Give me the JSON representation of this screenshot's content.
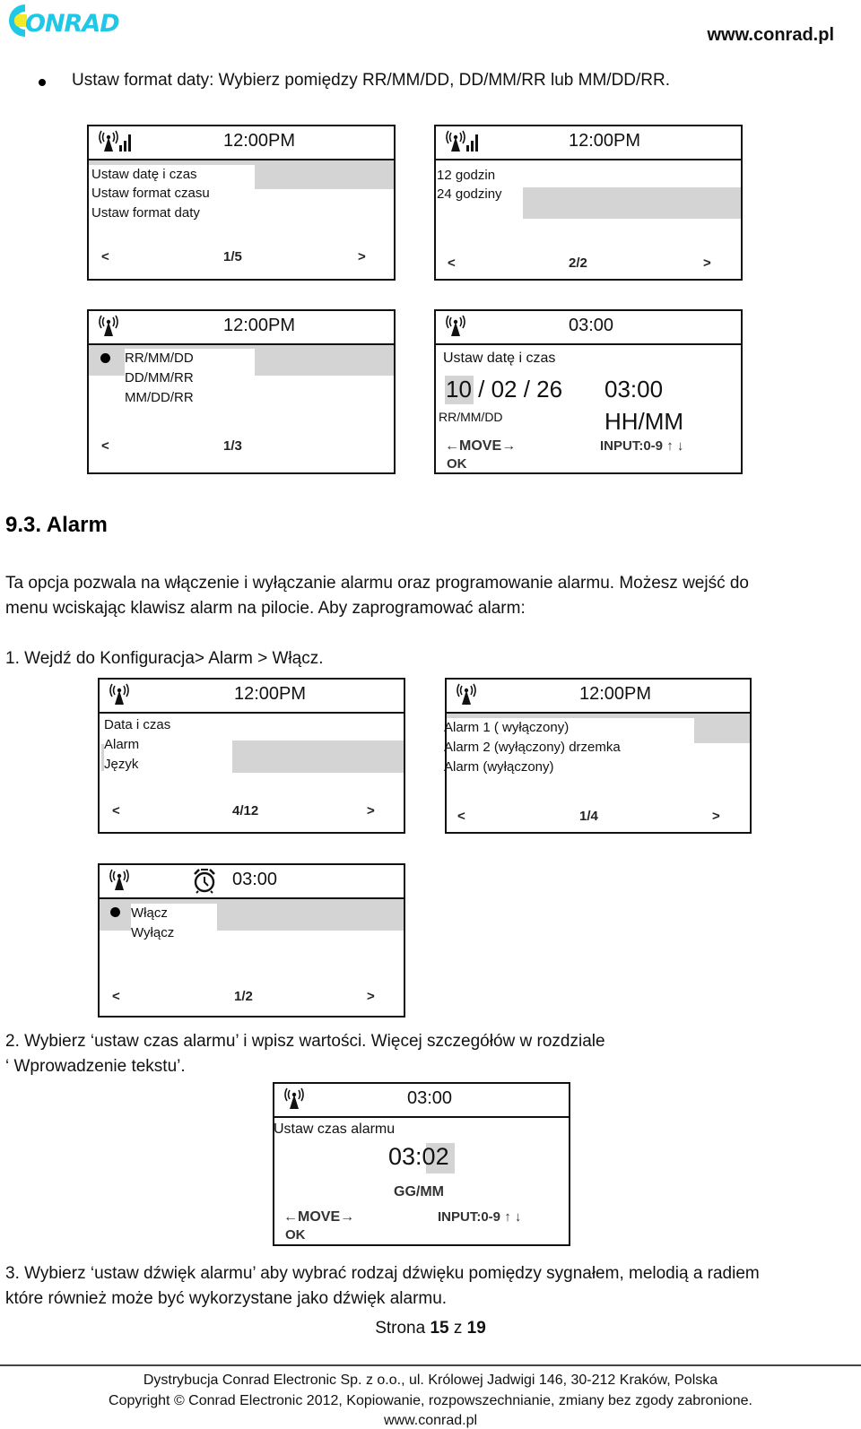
{
  "header": {
    "logo_text": "CONRAD",
    "website": "www.conrad.pl"
  },
  "bullet": "Ustaw format daty: Wybierz pomiędzy RR/MM/DD, DD/MM/RR lub MM/DD/RR.",
  "screens": {
    "s1": {
      "time": "12:00PM",
      "items": [
        "Ustaw datę i czas",
        "Ustaw format czasu",
        "Ustaw format daty"
      ],
      "prev": "<",
      "page": "1/5",
      "next": ">"
    },
    "s2": {
      "time": "12:00PM",
      "items": [
        "12 godzin",
        "24 godziny"
      ],
      "prev": "<",
      "page": "2/2",
      "next": ">"
    },
    "s3": {
      "time": "12:00PM",
      "items": [
        "RR/MM/DD",
        "DD/MM/RR",
        "MM/DD/RR"
      ],
      "prev": "<",
      "page": "1/3"
    },
    "s4": {
      "time": "03:00",
      "title": "Ustaw datę i czas",
      "date_year": "10",
      "date_rest": " / 02 / 26",
      "clock": "03:00",
      "date_format": "RR/MM/DD",
      "time_format": "HH/MM",
      "move": "←MOVE→",
      "input": "INPUT:0-9",
      "arrows": "↑ ↓",
      "ok": "OK"
    },
    "s5": {
      "time": "12:00PM",
      "items": [
        "Data i czas",
        "Alarm",
        "Język"
      ],
      "prev": "<",
      "page": "4/12",
      "next": ">"
    },
    "s6": {
      "time": "12:00PM",
      "items": [
        "Alarm 1 ( wyłączony)",
        "Alarm 2 (wyłączony) drzemka",
        "Alarm (wyłączony)"
      ],
      "prev": "<",
      "page": "1/4",
      "next": ">"
    },
    "s7": {
      "time": "03:00",
      "items": [
        "Włącz",
        "Wyłącz"
      ],
      "prev": "<",
      "page": "1/2",
      "next": ">"
    },
    "s8": {
      "time": "03:00",
      "title": "Ustaw czas alarmu",
      "clock_h": "03:",
      "clock_m": "02",
      "format": "GG/MM",
      "move": "←MOVE→",
      "input": "INPUT:0-9",
      "arrows": "↑ ↓",
      "ok": "OK"
    }
  },
  "section": {
    "title": "9.3. Alarm",
    "intro_line1": "Ta opcja pozwala na włączenie i wyłączanie alarmu oraz programowanie alarmu. Możesz wejść do",
    "intro_line2": "menu wciskając klawisz alarm na pilocie. Aby zaprogramować alarm:",
    "step1": "1. Wejdź do Konfiguracja> Alarm > Włącz.",
    "step2_line1": "2. Wybierz ‘ustaw czas alarmu’ i wpisz wartości. Więcej szczegółów w rozdziale",
    "step2_line2": "‘ Wprowadzenie tekstu’.",
    "step3_line1": "3. Wybierz ‘ustaw dźwięk alarmu’ aby wybrać rodzaj dźwięku pomiędzy sygnałem, melodią a radiem",
    "step3_line2": "które również może być wykorzystane jako dźwięk alarmu."
  },
  "footer": {
    "page_prefix": "Strona ",
    "page_current": "15",
    "page_mid": " z ",
    "page_total": "19",
    "distribution": "Dystrybucja Conrad Electronic Sp. z o.o., ul. Królowej Jadwigi 146, 30-212 Kraków, Polska",
    "copyright": "Copyright © Conrad Electronic 2012, Kopiowanie, rozpowszechnianie, zmiany bez zgody zabronione.",
    "website": "www.conrad.pl"
  },
  "colors": {
    "logo_cyan": "#1ec8e6",
    "logo_yellow": "#f2ea2a",
    "highlight_gray": "#d4d4d4"
  }
}
